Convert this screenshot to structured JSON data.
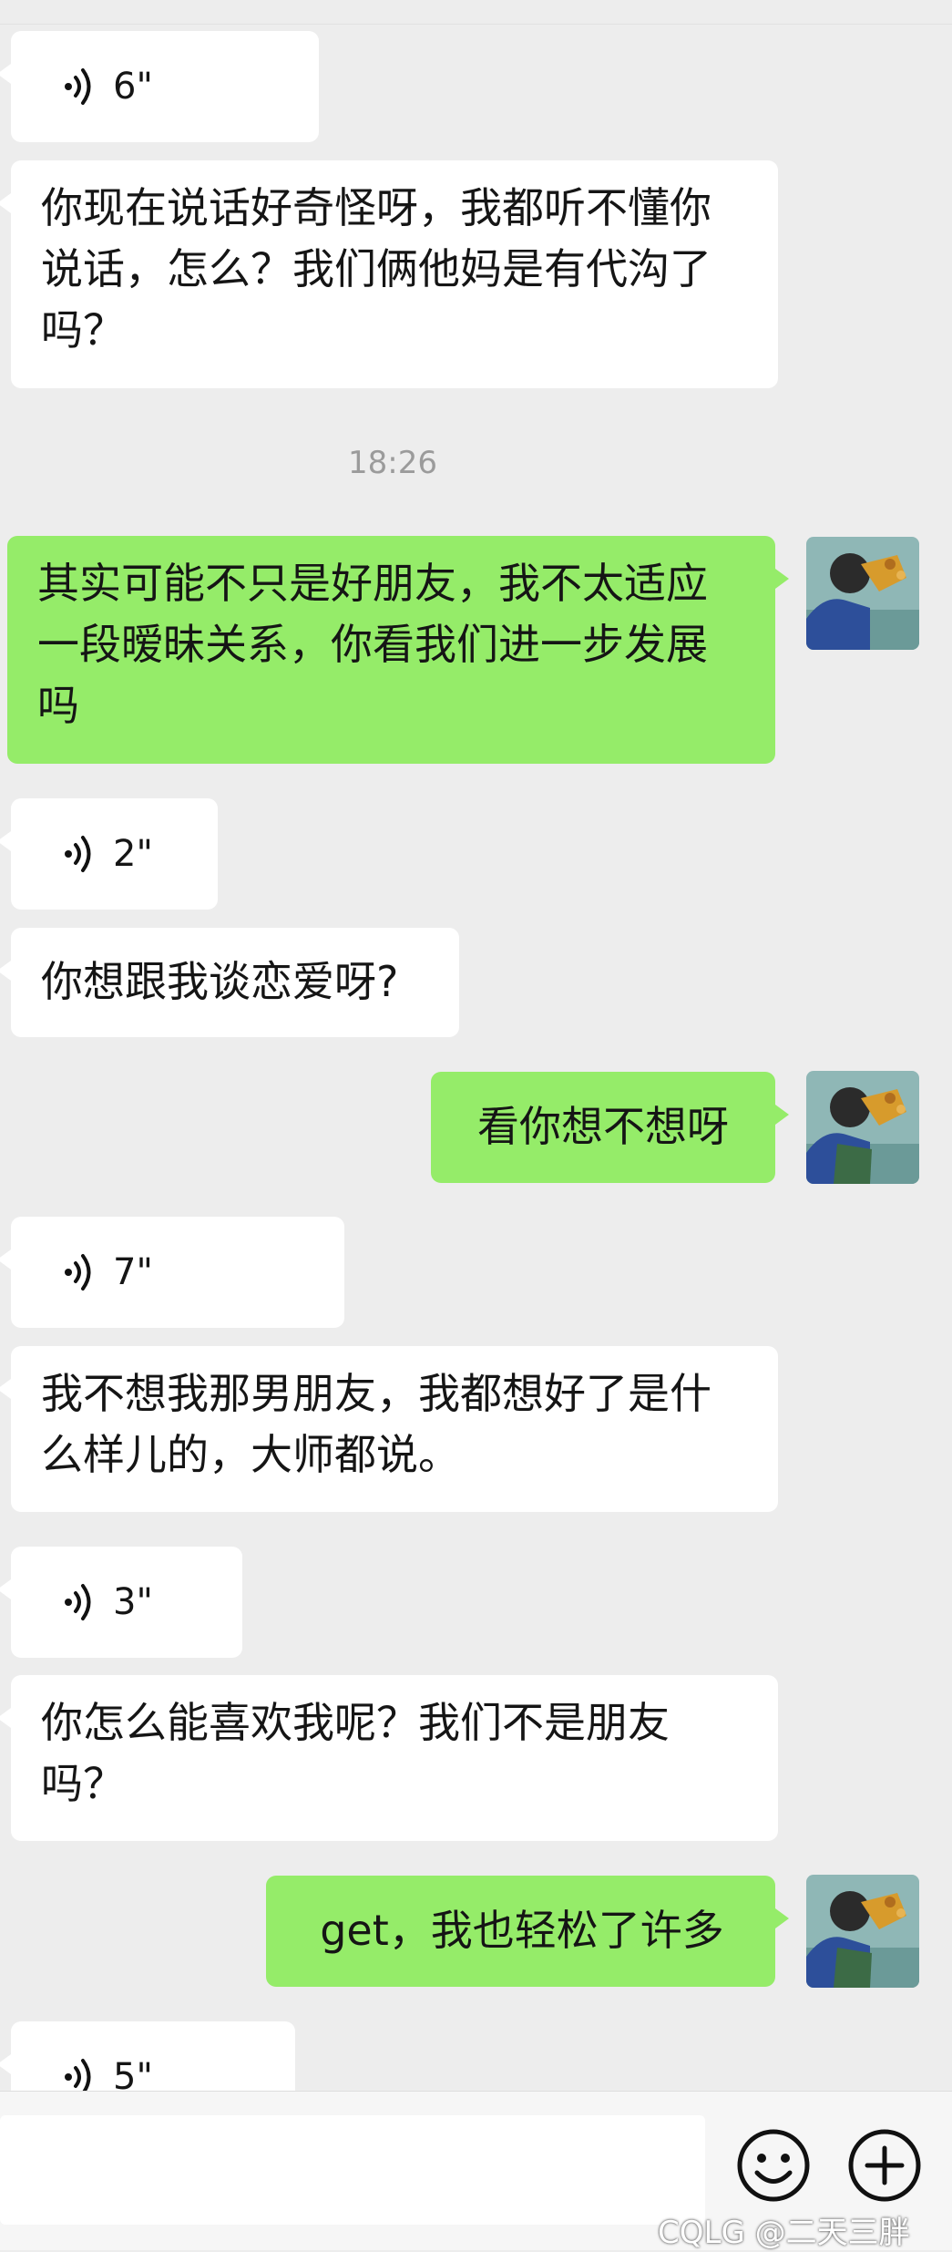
{
  "messages": [
    {
      "kind": "voice",
      "side": "in",
      "duration": "6\""
    },
    {
      "kind": "text",
      "side": "in",
      "text": "你现在说话好奇怪呀，我都听不懂你说话，怎么？我们俩他妈是有代沟了吗？"
    },
    {
      "kind": "time",
      "text": "18:26"
    },
    {
      "kind": "text",
      "side": "out",
      "text": "其实可能不只是好朋友，我不太适应一段暧昧关系，你看我们进一步发展吗"
    },
    {
      "kind": "voice",
      "side": "in",
      "duration": "2\""
    },
    {
      "kind": "text",
      "side": "in",
      "text": "你想跟我谈恋爱呀?"
    },
    {
      "kind": "text",
      "side": "out",
      "text": "看你想不想呀"
    },
    {
      "kind": "voice",
      "side": "in",
      "duration": "7\""
    },
    {
      "kind": "text",
      "side": "in",
      "text": "我不想我那男朋友，我都想好了是什么样儿的，大师都说。"
    },
    {
      "kind": "voice",
      "side": "in",
      "duration": "3\""
    },
    {
      "kind": "text",
      "side": "in",
      "text": "你怎么能喜欢我呢？我们不是朋友吗？"
    },
    {
      "kind": "text",
      "side": "out",
      "text": "get，我也轻松了许多"
    },
    {
      "kind": "voice",
      "side": "in",
      "duration": "5\""
    }
  ],
  "input": {
    "value": ""
  },
  "watermark": "CQLG @二天三胖",
  "colors": {
    "background": "#ededed",
    "incoming": "#ffffff",
    "outgoing": "#95ec69",
    "timestamp": "#9b9b9b"
  },
  "icons": {
    "voice": "voice-wave-icon",
    "emoji": "emoji-icon",
    "more": "plus-circle-icon",
    "avatar": "user-avatar"
  }
}
